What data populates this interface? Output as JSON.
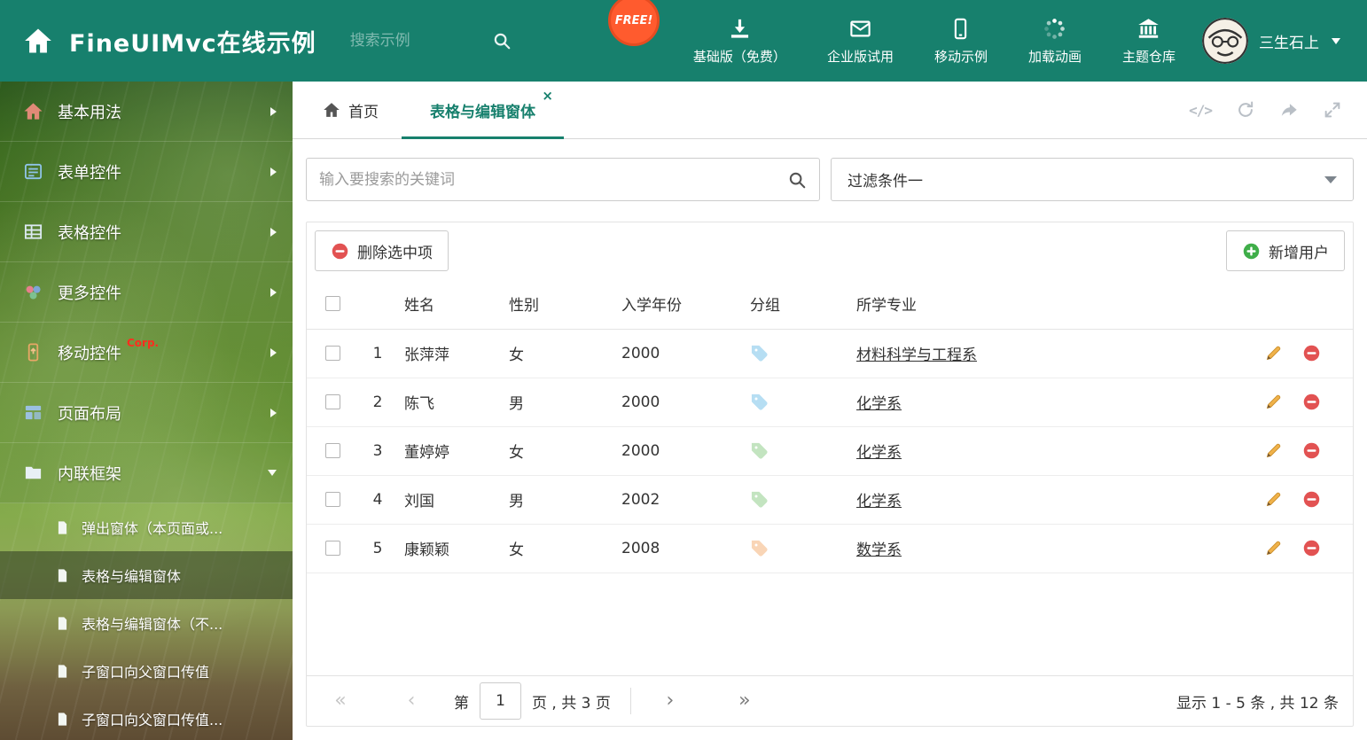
{
  "colors": {
    "accent": "#17806d",
    "danger": "#e25252",
    "success": "#3fae49",
    "pencil": "#f0b24a"
  },
  "header": {
    "title": "FineUIMvc在线示例",
    "search_placeholder": "搜索示例",
    "free_badge": "FREE!",
    "nav_items": [
      {
        "label": "基础版（免费）",
        "icon": "download-icon"
      },
      {
        "label": "企业版试用",
        "icon": "mail-icon"
      },
      {
        "label": "移动示例",
        "icon": "mobile-icon"
      },
      {
        "label": "加载动画",
        "icon": "spinner-icon"
      },
      {
        "label": "主题仓库",
        "icon": "bank-icon"
      }
    ],
    "user_name": "三生石上"
  },
  "sidebar": {
    "items": [
      {
        "label": "基本用法",
        "icon": "home-icon"
      },
      {
        "label": "表单控件",
        "icon": "form-icon"
      },
      {
        "label": "表格控件",
        "icon": "grid-icon"
      },
      {
        "label": "更多控件",
        "icon": "widgets-icon"
      },
      {
        "label": "移动控件",
        "icon": "mobile-icon",
        "badge": "Corp."
      },
      {
        "label": "页面布局",
        "icon": "layout-icon"
      },
      {
        "label": "内联框架",
        "icon": "folder-icon"
      }
    ],
    "subitems": [
      {
        "label": "弹出窗体（本页面或..."
      },
      {
        "label": "表格与编辑窗体"
      },
      {
        "label": "表格与编辑窗体（不..."
      },
      {
        "label": "子窗口向父窗口传值"
      },
      {
        "label": "子窗口向父窗口传值..."
      }
    ]
  },
  "tabs": {
    "home_label": "首页",
    "active_label": "表格与编辑窗体",
    "close_glyph": "×"
  },
  "window_actions": [
    "code-icon",
    "refresh-icon",
    "share-icon",
    "expand-icon"
  ],
  "filter": {
    "search_placeholder": "输入要搜索的关键词",
    "dropdown_value": "过滤条件一"
  },
  "toolbar": {
    "delete_label": "删除选中项",
    "add_label": "新增用户"
  },
  "table": {
    "columns": {
      "name": "姓名",
      "gender": "性别",
      "year": "入学年份",
      "group": "分组",
      "major": "所学专业"
    },
    "rows": [
      {
        "index": "1",
        "name": "张萍萍",
        "gender": "女",
        "year": "2000",
        "tag_color": "#5fb7e5",
        "major": "材料科学与工程系"
      },
      {
        "index": "2",
        "name": "陈飞",
        "gender": "男",
        "year": "2000",
        "tag_color": "#5fb7e5",
        "major": "化学系"
      },
      {
        "index": "3",
        "name": "董婷婷",
        "gender": "女",
        "year": "2000",
        "tag_color": "#7cc576",
        "major": "化学系"
      },
      {
        "index": "4",
        "name": "刘国",
        "gender": "男",
        "year": "2002",
        "tag_color": "#7cc576",
        "major": "化学系"
      },
      {
        "index": "5",
        "name": "康颖颖",
        "gender": "女",
        "year": "2008",
        "tag_color": "#f2a35e",
        "major": "数学系"
      }
    ]
  },
  "pagination": {
    "page_prefix": "第",
    "current_page": "1",
    "page_suffix": "页 , 共 3 页",
    "summary": "显示 1 - 5 条 , 共 12 条"
  }
}
